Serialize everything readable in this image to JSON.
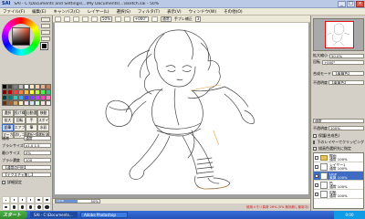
{
  "window": {
    "app_name": "SAI",
    "title": "SAI - C:\\Documents and Settings\\...\\My Documents\\...\\sketch.sai - 50%",
    "min": "_",
    "max": "□",
    "close": "×"
  },
  "menu": [
    "ファイル(F)",
    "編集(E)",
    "キャンバス(C)",
    "レイヤー(L)",
    "選択(S)",
    "フィルタ(T)",
    "表示(V)",
    "ウィンドウ(W)",
    "その他(O)"
  ],
  "toolbar": {
    "zoom_value": "50%",
    "angle_value": "+000°",
    "mode_label": "通常",
    "stabilizer_label": "手ブレ補正",
    "stabilizer_value": "3"
  },
  "palette": {
    "swatches": [
      "#000000",
      "#404040",
      "#808080",
      "#c0c0c0",
      "#ffffff",
      "#ffe8d0",
      "#f8d0b0",
      "#e8b090",
      "#c08060",
      "#800000",
      "#c00000",
      "#ff4040",
      "#ff8040",
      "#ffc040",
      "#ffff40",
      "#c0ff40",
      "#40ff40",
      "#40c080",
      "#004040",
      "#008080",
      "#40c0c0",
      "#40a0ff",
      "#4040ff",
      "#8040ff",
      "#c040ff",
      "#ff40c0",
      "#ff80c0",
      "#603010",
      "#a06030",
      "#e0a060",
      "#fff0c0",
      "#f0e0ff",
      "#d0e8ff",
      "#d0ffe0",
      "#ffe0e0",
      "#f0f0f0"
    ]
  },
  "tools": [
    "選択",
    "投げ縄",
    "自動選択",
    "移動",
    "拡大",
    "回転",
    "手",
    "スポイト",
    "鉛筆",
    "エアブラシ",
    "筆",
    "水彩",
    "マーカー",
    "消しゴム",
    "選択ペン",
    "選択消し"
  ],
  "brush_props": {
    "mode_label": "通常",
    "mode_value": "通常",
    "size_label": "ブラシサイズ",
    "size_value": "x1.0  1.5",
    "min_label": "最小サイズ",
    "min_value": "0%",
    "density_label": "ブラシ濃度",
    "density_value": "100",
    "shape_label": "【通常の円形】",
    "texture_label": "【テクスチャ無し】",
    "detail_label": "詳細設定"
  },
  "brushes": [
    "0.7",
    "0.8",
    "1",
    "1.5",
    "2",
    "2.3",
    "2.6",
    "3",
    "3.5",
    "4",
    "5",
    "6",
    "7",
    "8",
    "9",
    "10",
    "12",
    "14"
  ],
  "canvas_status": {
    "layer_name": "Line",
    "zoom": "50%",
    "message": "使用メモリ負荷 26% (5% 無効無し使用中)"
  },
  "right_panel": {
    "zoom_label": "拡大縮小",
    "zoom_value": "50.0%",
    "angle_label": "回転",
    "angle_value": "+000°",
    "mode_label": "合成モード",
    "mode_value": "【乗算色】",
    "opacity_label": "不透明度",
    "opacity_value": "【乗算色】",
    "blend_label": "通常",
    "opacity2_label": "不透明度",
    "opacity2_value": "100%",
    "check1": "保護(合成色)",
    "check2": "下のレイヤーでクリッピング",
    "check3": "描画色選択先に指定"
  },
  "layers": [
    {
      "name": "線画",
      "mode": "通常 100%",
      "type": "folder"
    },
    {
      "name": "レイヤー1",
      "mode": "通常 100%",
      "type": "layer"
    },
    {
      "name": "Line",
      "mode": "乗算 100%",
      "type": "layer",
      "selected": true
    },
    {
      "name": "色",
      "mode": "通常 100%",
      "type": "layer"
    },
    {
      "name": "用紙",
      "mode": "通常 100%",
      "type": "layer"
    }
  ],
  "taskbar": {
    "start": "スタート",
    "tasks": [
      "SAI - C:\\Documents...",
      "Adobe Photoshop"
    ],
    "clock": "0:00"
  }
}
